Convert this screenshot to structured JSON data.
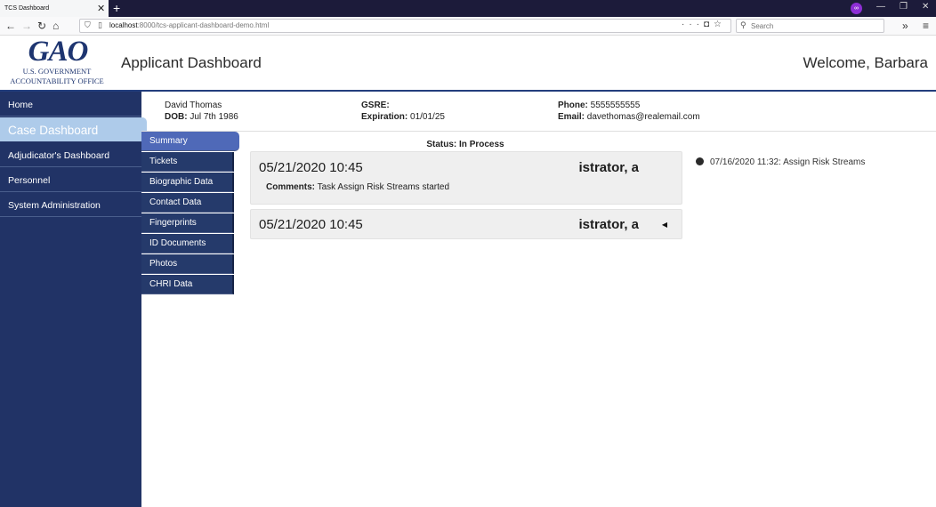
{
  "browser": {
    "tab_title": "TCS Dashboard",
    "tab_close": "✕",
    "new_tab": "+",
    "url_host": "localhost",
    "url_path": ":8000/tcs-applicant-dashboard-demo.html",
    "search_placeholder": "Search",
    "icons": [
      "back-icon",
      "forward-icon",
      "reload-icon",
      "home-icon",
      "shield-icon",
      "page-icon",
      "more-icon",
      "pocket-icon",
      "bookmark-icon",
      "search-icon",
      "overflow-icon",
      "menu-icon",
      "private-mask-icon",
      "minimize-icon",
      "maximize-icon",
      "close-icon"
    ]
  },
  "header": {
    "logo_text": "GAO",
    "logo_line1": "U.S. GOVERNMENT",
    "logo_line2": "ACCOUNTABILITY OFFICE",
    "page_title": "Applicant Dashboard",
    "welcome": "Welcome, Barbara"
  },
  "sidebar": {
    "items": [
      {
        "label": "Home",
        "active": false
      },
      {
        "label": "Case Dashboard",
        "active": true
      },
      {
        "label": "Adjudicator's Dashboard",
        "active": false
      },
      {
        "label": "Personnel",
        "active": false
      },
      {
        "label": "System Administration",
        "active": false
      }
    ]
  },
  "subnav": {
    "items": [
      {
        "label": "Summary",
        "active": true
      },
      {
        "label": "Tickets",
        "active": false
      },
      {
        "label": "Biographic Data",
        "active": false
      },
      {
        "label": "Contact Data",
        "active": false
      },
      {
        "label": "Fingerprints",
        "active": false
      },
      {
        "label": "ID Documents",
        "active": false
      },
      {
        "label": "Photos",
        "active": false
      },
      {
        "label": "CHRI Data",
        "active": false
      }
    ]
  },
  "applicant": {
    "name": "David Thomas",
    "dob_label": "DOB:",
    "dob": "Jul 7th 1986",
    "gsre_label": "GSRE:",
    "gsre": "",
    "expiration_label": "Expiration:",
    "expiration": "01/01/25",
    "phone_label": "Phone:",
    "phone": "5555555555",
    "email_label": "Email:",
    "email": "davethomas@realemail.com"
  },
  "main": {
    "status": "Status: In Process",
    "entries": [
      {
        "date": "05/21/2020 10:45",
        "who": "istrator, a",
        "comments_label": "Comments:",
        "comments": "Task Assign Risk Streams started",
        "expanded": true
      },
      {
        "date": "05/21/2020 10:45",
        "who": "istrator, a",
        "toggle": "◀",
        "expanded": false
      }
    ]
  },
  "timeline": {
    "items": [
      {
        "text": "07/16/2020 11:32: Assign Risk Streams"
      }
    ]
  },
  "colors": {
    "nav_bg": "#213366",
    "active_nav": "#aecbea",
    "subnav_active": "#4f69b8",
    "rule": "#233e7d",
    "card_bg": "#efefef"
  }
}
